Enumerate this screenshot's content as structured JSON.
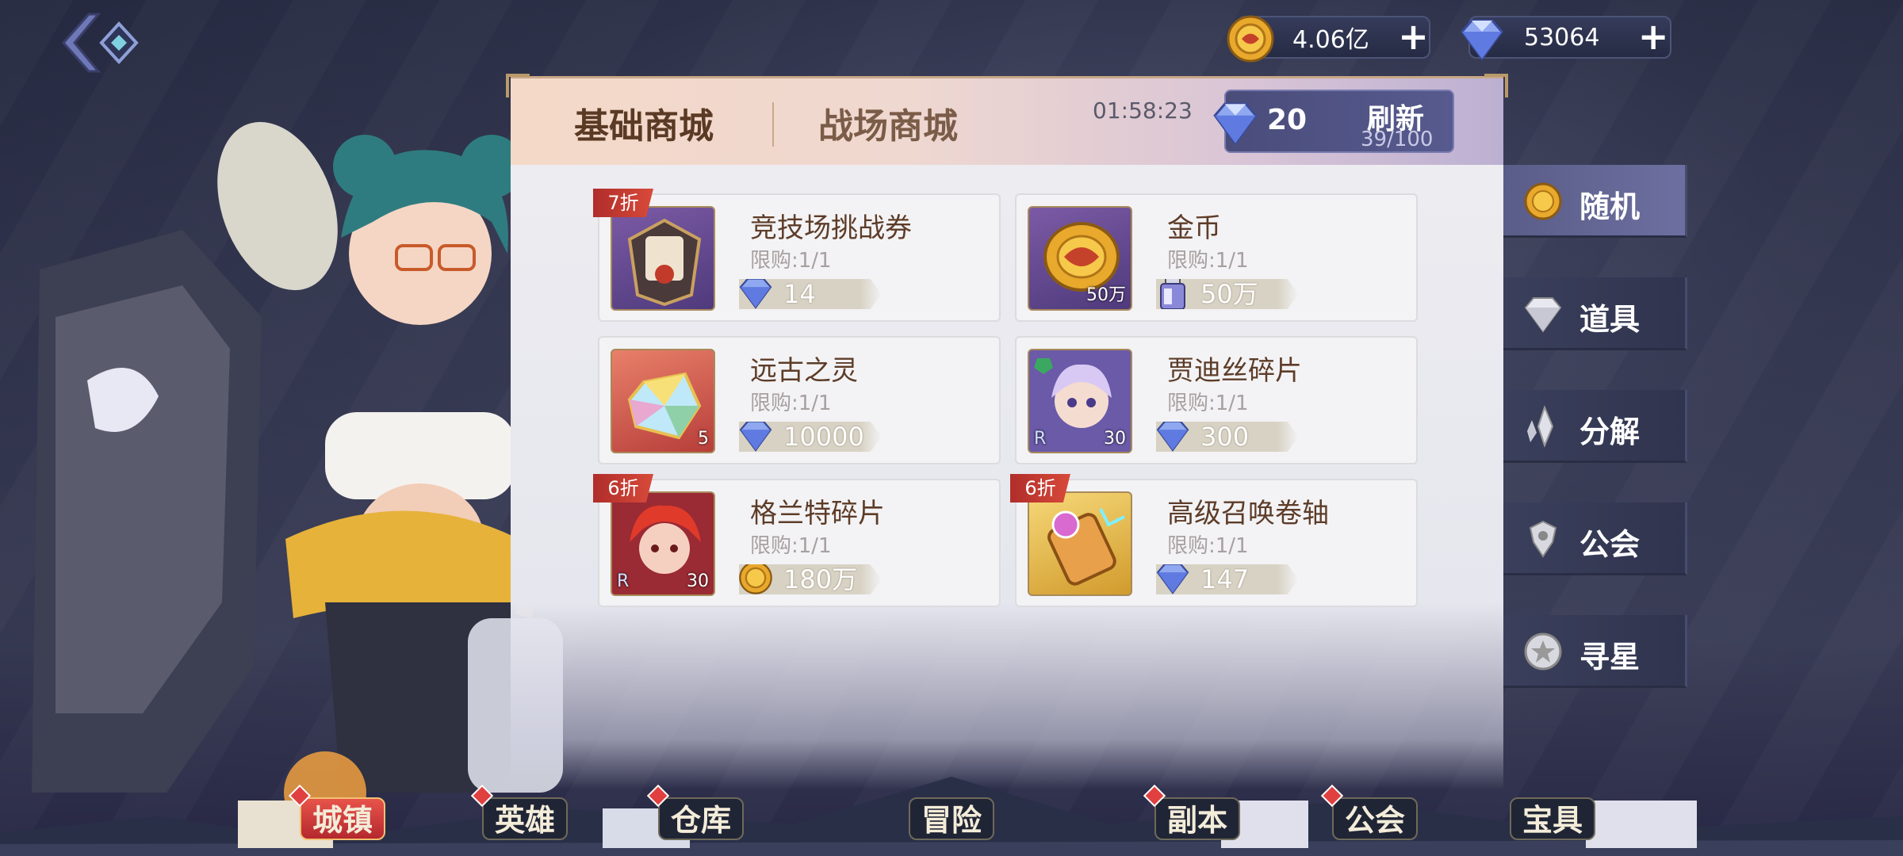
{
  "currency": {
    "gold": {
      "value": "4.06亿",
      "icon": "gold-coin-icon"
    },
    "gems": {
      "value": "53064",
      "icon": "diamond-icon"
    },
    "add_label": "+"
  },
  "shop": {
    "tabs": [
      {
        "label": "基础商城",
        "active": true
      },
      {
        "label": "战场商城",
        "active": false
      }
    ],
    "timer": "01:58:23",
    "refresh": {
      "cost": "20",
      "label": "刷新",
      "count": "39/100"
    },
    "items": [
      {
        "name": "竞技场挑战券",
        "limit": "限购:1/1",
        "price": "14",
        "currency": "diamond",
        "badge": "7折",
        "qty": ""
      },
      {
        "name": "金币",
        "limit": "限购:1/1",
        "price": "50万",
        "currency": "potion",
        "badge": "",
        "qty": "50万"
      },
      {
        "name": "远古之灵",
        "limit": "限购:1/1",
        "price": "10000",
        "currency": "diamond",
        "badge": "",
        "qty": "5"
      },
      {
        "name": "贾迪丝碎片",
        "limit": "限购:1/1",
        "price": "300",
        "currency": "diamond",
        "badge": "",
        "qty": "30"
      },
      {
        "name": "格兰特碎片",
        "limit": "限购:1/1",
        "price": "180万",
        "currency": "gold",
        "badge": "6折",
        "qty": "30"
      },
      {
        "name": "高级召唤卷轴",
        "limit": "限购:1/1",
        "price": "147",
        "currency": "diamond",
        "badge": "6折",
        "qty": ""
      }
    ],
    "rarity_letter": "R"
  },
  "categories": [
    {
      "label": "随机",
      "icon": "gold-coin-icon",
      "active": true
    },
    {
      "label": "道具",
      "icon": "diamond-icon",
      "active": false
    },
    {
      "label": "分解",
      "icon": "crystal-shard-icon",
      "active": false
    },
    {
      "label": "公会",
      "icon": "guild-crest-icon",
      "active": false
    },
    {
      "label": "寻星",
      "icon": "star-medal-icon",
      "active": false
    }
  ],
  "nav": [
    {
      "label": "城镇",
      "active": true,
      "dot": true
    },
    {
      "label": "英雄",
      "active": false,
      "dot": true
    },
    {
      "label": "仓库",
      "active": false,
      "dot": true
    },
    {
      "label": "冒险",
      "active": false,
      "dot": false
    },
    {
      "label": "副本",
      "active": false,
      "dot": true
    },
    {
      "label": "公会",
      "active": false,
      "dot": true
    },
    {
      "label": "宝具",
      "active": false,
      "dot": false
    }
  ],
  "colors": {
    "accent_red": "#d84a3a",
    "panel_bg": "#ececf1",
    "text_brown": "#5d3c28"
  }
}
